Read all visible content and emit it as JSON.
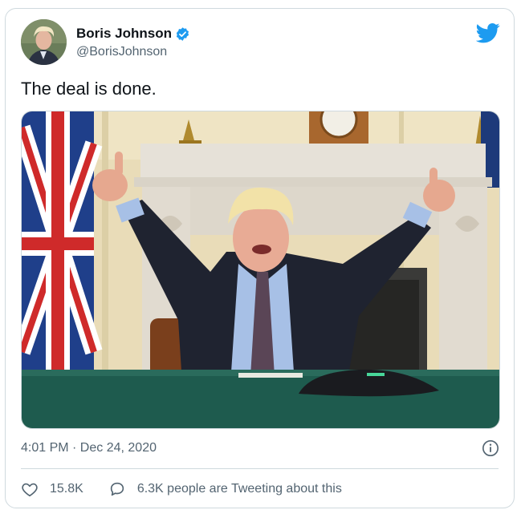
{
  "tweet": {
    "author_name": "Boris Johnson",
    "author_handle": "@BorisJohnson",
    "text": "The deal is done.",
    "timestamp": "4:01 PM · Dec 24, 2020",
    "likes": "15.8K",
    "tweeting_text": "6.3K people are Tweeting about this"
  },
  "icons": {
    "verified": "verified-badge-icon",
    "bird": "twitter-bird-icon",
    "info": "info-icon",
    "heart": "heart-icon",
    "comment": "speech-bubble-icon"
  },
  "colors": {
    "brand_blue": "#1d9bf0",
    "text_primary": "#0f1419",
    "text_secondary": "#536471",
    "border": "#cfd9de"
  }
}
